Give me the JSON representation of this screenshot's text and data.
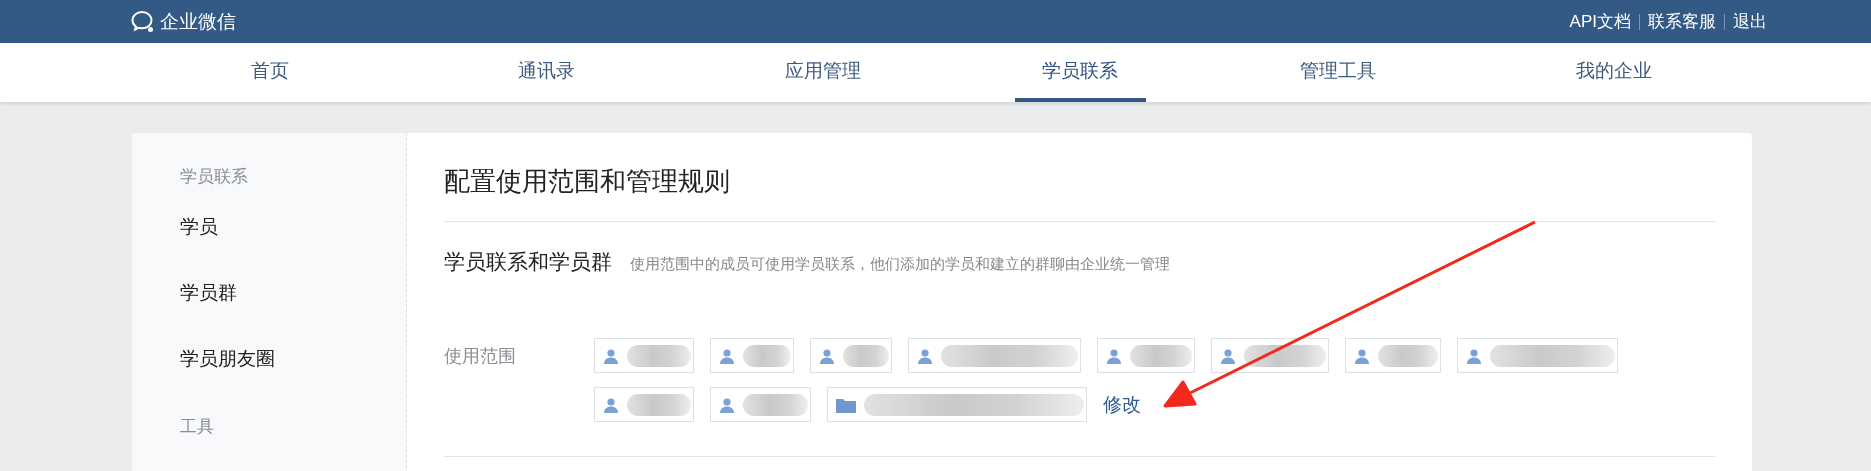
{
  "header": {
    "logo_text": "企业微信",
    "links": [
      "API文档",
      "联系客服",
      "退出"
    ]
  },
  "nav": {
    "tabs": [
      {
        "label": "首页",
        "selected": false
      },
      {
        "label": "通讯录",
        "selected": false
      },
      {
        "label": "应用管理",
        "selected": false
      },
      {
        "label": "学员联系",
        "selected": true
      },
      {
        "label": "管理工具",
        "selected": false
      },
      {
        "label": "我的企业",
        "selected": false
      }
    ]
  },
  "sidebar": {
    "groups": [
      {
        "title": "学员联系",
        "items": [
          "学员",
          "学员群",
          "学员朋友圈"
        ]
      },
      {
        "title": "工具"
      }
    ]
  },
  "content": {
    "title": "配置使用范围和管理规则",
    "section": {
      "heading": "学员联系和学员群",
      "description": "使用范围中的成员可使用学员联系，他们添加的学员和建立的群聊由企业统一管理",
      "field_label": "使用范围",
      "members": [
        {
          "kind": "person"
        },
        {
          "kind": "person"
        },
        {
          "kind": "person"
        },
        {
          "kind": "person"
        },
        {
          "kind": "person"
        },
        {
          "kind": "person"
        },
        {
          "kind": "person"
        },
        {
          "kind": "person"
        },
        {
          "kind": "person"
        },
        {
          "kind": "person"
        },
        {
          "kind": "department"
        }
      ],
      "edit_link": "修改"
    }
  },
  "annotations": [
    {
      "kind": "arrow"
    }
  ]
}
